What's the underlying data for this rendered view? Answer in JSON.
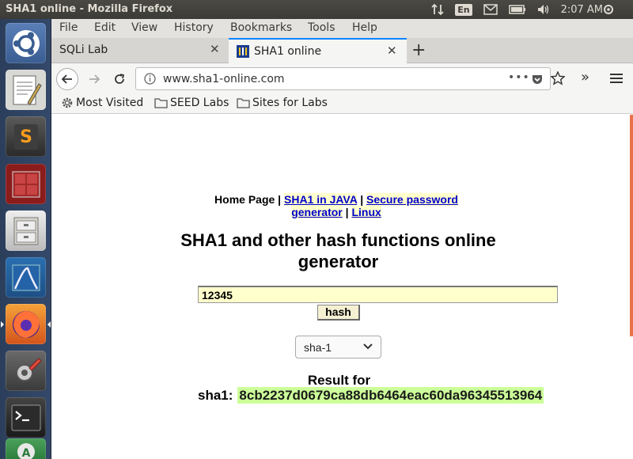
{
  "system": {
    "window_title": "SHA1 online - Mozilla Firefox",
    "keyboard_layout": "En",
    "clock": "2:07 AM"
  },
  "launcher": {
    "items": [
      "ubuntu-dash",
      "text-editor",
      "sublime-text",
      "workspaces",
      "file-manager",
      "wireshark",
      "firefox",
      "system-settings",
      "terminal",
      "software-updater"
    ]
  },
  "menubar": {
    "items": [
      "File",
      "Edit",
      "View",
      "History",
      "Bookmarks",
      "Tools",
      "Help"
    ]
  },
  "tabs": [
    {
      "label": "SQLi Lab",
      "active": false
    },
    {
      "label": "SHA1 online",
      "active": true
    }
  ],
  "navbar": {
    "url_host": "www.sha1-online.com"
  },
  "bookmarks": [
    {
      "label": "Most Visited",
      "icon": "gear-icon"
    },
    {
      "label": "SEED Labs",
      "icon": "folder-icon"
    },
    {
      "label": "Sites for Labs",
      "icon": "folder-icon"
    }
  ],
  "page": {
    "nav": {
      "home": "Home Page",
      "sep1": " | ",
      "sha1_java": "SHA1 in JAVA",
      "sep2": " | ",
      "secure_pw": "Secure password generator",
      "sep3": " | ",
      "linux": "Linux"
    },
    "heading": "SHA1 and other hash functions online generator",
    "input_value": "12345",
    "hash_button": "hash",
    "algorithm": "sha-1",
    "result_label": "Result for",
    "result_algo": "sha1:",
    "result_hash": "8cb2237d0679ca88db6464eac60da96345513964"
  },
  "colors": {
    "accent_tab": "#0a84ff",
    "input_bg": "#ffffcc",
    "result_bg": "#ccff99",
    "link": "#0000cc"
  }
}
